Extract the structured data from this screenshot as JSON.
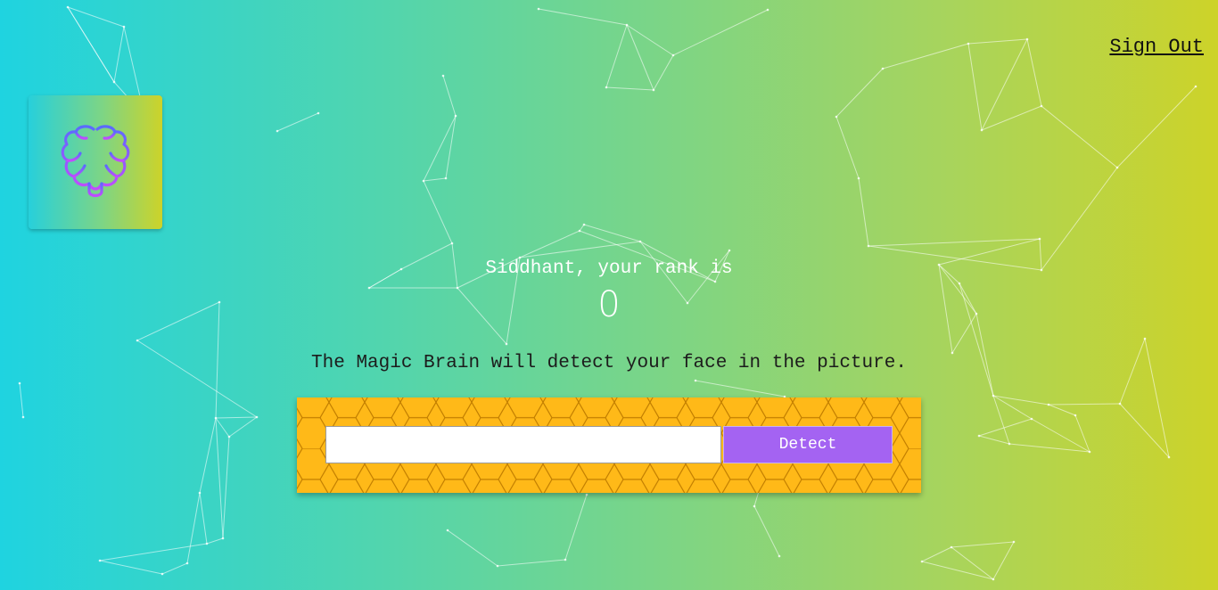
{
  "nav": {
    "signout_label": "Sign Out"
  },
  "logo": {
    "icon": "brain-icon",
    "gradient_start": "#6a5cff",
    "gradient_end": "#c04bff"
  },
  "rank": {
    "message": "Siddhant, your rank is",
    "value": "0"
  },
  "instruction": "The Magic Brain will detect your face in the picture.",
  "form": {
    "input_value": "",
    "input_placeholder": "",
    "detect_label": "Detect"
  },
  "colors": {
    "background_start": "#1fd3e0",
    "background_end": "#cdd329",
    "panel": "#ffb918",
    "button": "#a463f2"
  }
}
